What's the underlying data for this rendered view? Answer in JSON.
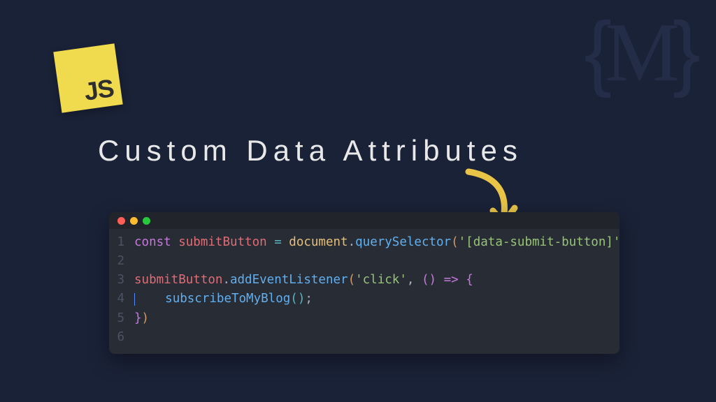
{
  "logo": {
    "text": "JS"
  },
  "watermark": {
    "left_brace": "{",
    "letter": "M",
    "right_brace": "}"
  },
  "title": "Custom Data Attributes",
  "code": {
    "lines": [
      "1",
      "2",
      "3",
      "4",
      "5",
      "6"
    ],
    "line1": {
      "const": "const",
      "var": "submitButton",
      "eq": " = ",
      "obj": "document",
      "dot": ".",
      "fn": "querySelector",
      "open": "(",
      "str": "'[data-submit-button]'",
      "close": ")",
      "semi": ";"
    },
    "line3": {
      "var": "submitButton",
      "dot": ".",
      "fn": "addEventListener",
      "open": "(",
      "str": "'click'",
      "comma": ", ",
      "paren_open": "(",
      "paren_close": ")",
      "arrow": " => ",
      "brace": "{"
    },
    "line4": {
      "indent": "    ",
      "fn": "subscribeToMyBlog",
      "open": "(",
      "close": ")",
      "semi": ";"
    },
    "line5": {
      "brace": "}",
      "close": ")"
    }
  }
}
